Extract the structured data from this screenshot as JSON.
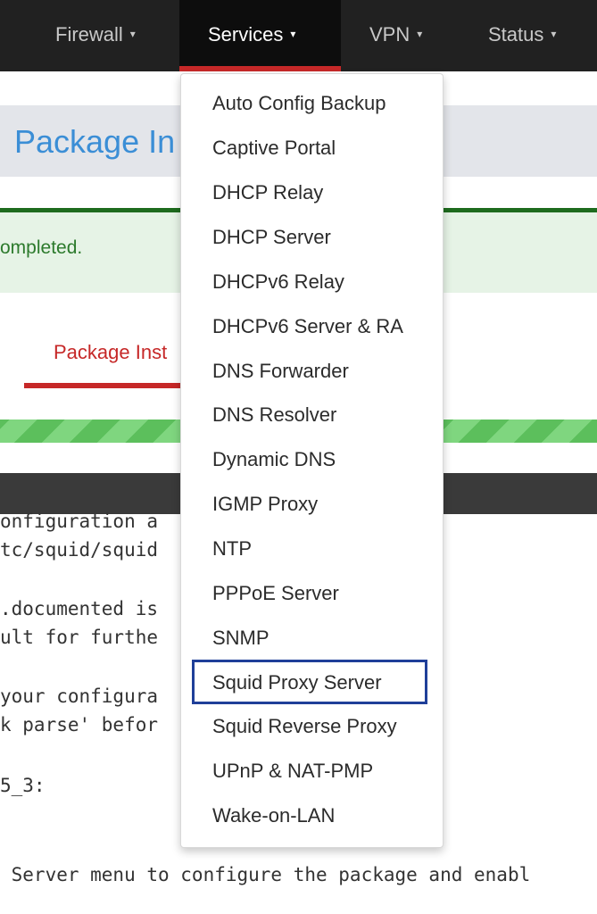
{
  "navbar": {
    "items": [
      {
        "label": "Firewall"
      },
      {
        "label": "Services"
      },
      {
        "label": "VPN"
      },
      {
        "label": "Status"
      }
    ],
    "caret": "▾"
  },
  "page": {
    "title": "Package In",
    "alert_text": "ompleted.",
    "tab_label": "Package Inst"
  },
  "console": {
    "lines": [
      "onfiguration a                    lt",
      "tc/squid/squid",
      "",
      ".documented is",
      "ult for furthe",
      "",
      "your configura",
      "k parse' befor",
      "",
      "5_3:",
      "",
      "",
      " Server menu to configure the package and enabl"
    ]
  },
  "services_menu": {
    "items": [
      "Auto Config Backup",
      "Captive Portal",
      "DHCP Relay",
      "DHCP Server",
      "DHCPv6 Relay",
      "DHCPv6 Server & RA",
      "DNS Forwarder",
      "DNS Resolver",
      "Dynamic DNS",
      "IGMP Proxy",
      "NTP",
      "PPPoE Server",
      "SNMP",
      "Squid Proxy Server",
      "Squid Reverse Proxy",
      "UPnP & NAT-PMP",
      "Wake-on-LAN"
    ],
    "highlighted": "Squid Proxy Server"
  },
  "colors": {
    "navbar": "#212121",
    "accent_red": "#c62828",
    "title_blue": "#3b8ed6",
    "success_green": "#2c7a2c",
    "highlight_border": "#1f3f99"
  }
}
